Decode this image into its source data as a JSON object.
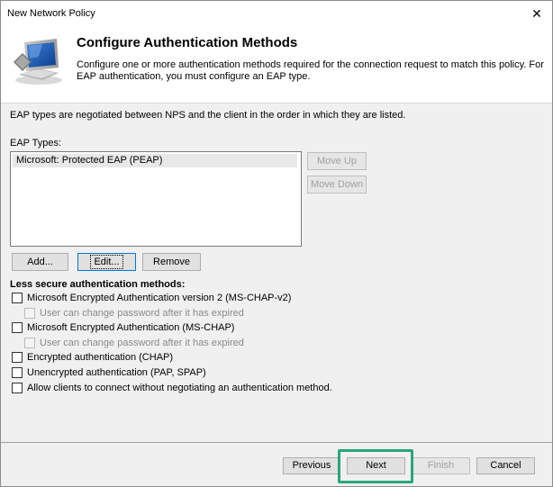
{
  "window": {
    "title": "New Network Policy",
    "close_glyph": "✕"
  },
  "header": {
    "title": "Configure Authentication Methods",
    "description": "Configure one or more authentication methods required for the connection request to match this policy. For EAP authentication, you must configure an EAP type."
  },
  "intro_text": "EAP types are negotiated between NPS and the client in the order in which they are listed.",
  "eap": {
    "label": "EAP Types:",
    "items": [
      "Microsoft: Protected EAP (PEAP)"
    ],
    "move_up": "Move Up",
    "move_down": "Move Down",
    "add": "Add...",
    "edit": "Edit...",
    "remove": "Remove"
  },
  "less_secure": {
    "title": "Less secure authentication methods:",
    "options": [
      {
        "label": "Microsoft Encrypted Authentication version 2 (MS-CHAP-v2)",
        "checked": false,
        "enabled": true
      },
      {
        "label": "User can change password after it has expired",
        "checked": false,
        "enabled": false
      },
      {
        "label": "Microsoft Encrypted Authentication (MS-CHAP)",
        "checked": false,
        "enabled": true
      },
      {
        "label": "User can change password after it has expired",
        "checked": false,
        "enabled": false
      },
      {
        "label": "Encrypted authentication (CHAP)",
        "checked": false,
        "enabled": true
      },
      {
        "label": "Unencrypted authentication (PAP, SPAP)",
        "checked": false,
        "enabled": true
      },
      {
        "label": "Allow clients to connect without negotiating an authentication method.",
        "checked": false,
        "enabled": true
      }
    ]
  },
  "footer": {
    "previous": "Previous",
    "next": "Next",
    "finish": "Finish",
    "cancel": "Cancel"
  },
  "colors": {
    "highlight": "#2aa57b",
    "focus_border": "#0078d7"
  },
  "icons": {
    "header": "network-monitor-icon",
    "close": "close-icon"
  }
}
